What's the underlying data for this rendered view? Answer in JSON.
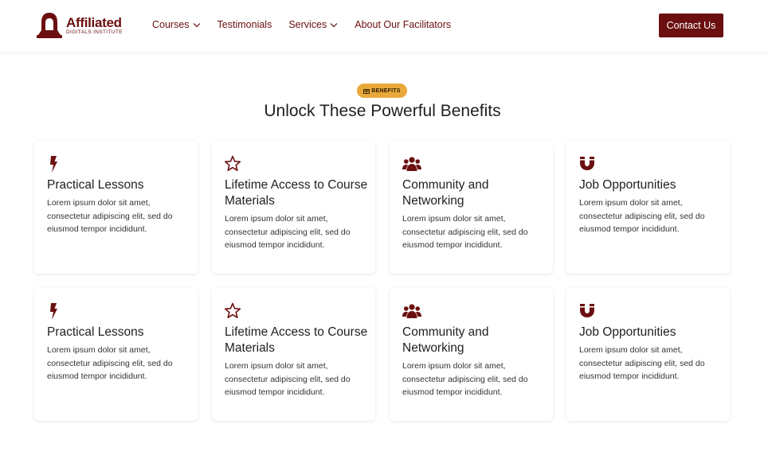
{
  "header": {
    "logo_name": "Affiliated",
    "logo_sub": "DIGITALS INSTITUTE",
    "nav": [
      {
        "label": "Courses",
        "has_dropdown": true
      },
      {
        "label": "Testimonials",
        "has_dropdown": false
      },
      {
        "label": "Services",
        "has_dropdown": true
      },
      {
        "label": "About Our Facilitators",
        "has_dropdown": false
      }
    ],
    "contact_label": "Contact Us"
  },
  "section": {
    "badge": "BENEFITS",
    "title": "Unlock These Powerful Benefits"
  },
  "cards": [
    {
      "icon": "lightning-icon",
      "title": "Practical Lessons",
      "desc": "Lorem ipsum dolor sit amet, consectetur adipiscing elit, sed do eiusmod tempor incididunt."
    },
    {
      "icon": "star-icon",
      "title": "Lifetime Access to Course Materials",
      "desc": "Lorem ipsum dolor sit amet, consectetur adipiscing elit, sed do eiusmod tempor incididunt."
    },
    {
      "icon": "users-icon",
      "title": "Community and Networking",
      "desc": "Lorem ipsum dolor sit amet, consectetur adipiscing elit, sed do eiusmod tempor incididunt."
    },
    {
      "icon": "magnet-icon",
      "title": "Job Opportunities",
      "desc": "Lorem ipsum dolor sit amet, consectetur adipiscing elit, sed do eiusmod tempor incididunt."
    },
    {
      "icon": "lightning-icon",
      "title": "Practical Lessons",
      "desc": "Lorem ipsum dolor sit amet, consectetur adipiscing elit, sed do eiusmod tempor incididunt."
    },
    {
      "icon": "star-icon",
      "title": "Lifetime Access to Course Materials",
      "desc": "Lorem ipsum dolor sit amet, consectetur adipiscing elit, sed do eiusmod tempor incididunt."
    },
    {
      "icon": "users-icon",
      "title": "Community and Networking",
      "desc": "Lorem ipsum dolor sit amet, consectetur adipiscing elit, sed do eiusmod tempor incididunt."
    },
    {
      "icon": "magnet-icon",
      "title": "Job Opportunities",
      "desc": "Lorem ipsum dolor sit amet, consectetur adipiscing elit, sed do eiusmod tempor incididunt."
    }
  ],
  "colors": {
    "brand": "#6b0f10",
    "badge": "#e9a93a",
    "text": "#1f1f1f"
  }
}
